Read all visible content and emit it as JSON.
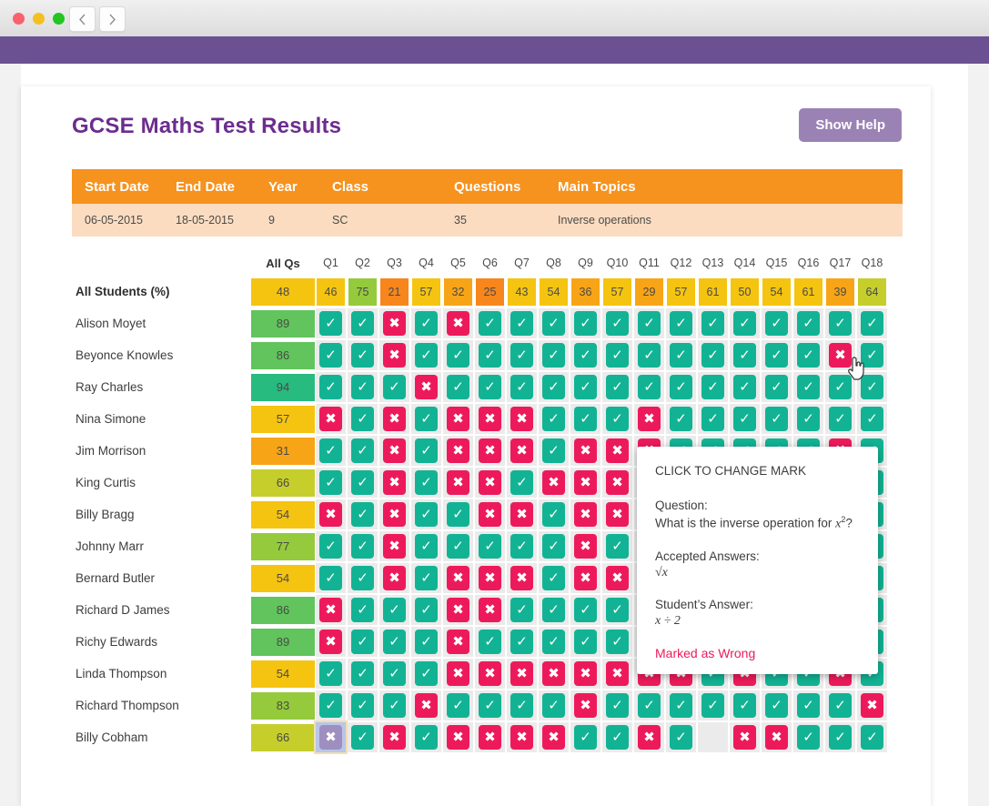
{
  "window": {
    "traffic_lights": [
      "close",
      "minimize",
      "maximize"
    ],
    "back_label": "‹",
    "forward_label": "›",
    "appbar_color": "#6b5191"
  },
  "header": {
    "title": "GCSE Maths Test Results",
    "help_button": "Show Help",
    "title_color": "#6c2d8e",
    "help_color": "#9b82b5"
  },
  "meta_table": {
    "columns": [
      "Start Date",
      "End Date",
      "Year",
      "Class",
      "Questions",
      "Main Topics"
    ],
    "row": [
      "06-05-2015",
      "18-05-2015",
      "9",
      "SC",
      "35",
      "Inverse operations"
    ],
    "header_color": "#f6921e",
    "row_color": "#fbdcc0"
  },
  "grid": {
    "all_qs_label": "All Qs",
    "question_headers": [
      "Q1",
      "Q2",
      "Q3",
      "Q4",
      "Q5",
      "Q6",
      "Q7",
      "Q8",
      "Q9",
      "Q10",
      "Q11",
      "Q12",
      "Q13",
      "Q14",
      "Q15",
      "Q16",
      "Q17",
      "Q18"
    ],
    "summary_row": {
      "label": "All Students (%)",
      "all": 48,
      "values": [
        46,
        75,
        21,
        57,
        32,
        25,
        43,
        54,
        36,
        57,
        29,
        57,
        61,
        50,
        54,
        61,
        39,
        64
      ]
    },
    "students": [
      {
        "name": "Alison Moyet",
        "score": 89,
        "marks": [
          "right",
          "right",
          "wrong",
          "right",
          "wrong",
          "right",
          "right",
          "right",
          "right",
          "right",
          "right",
          "right",
          "right",
          "right",
          "right",
          "right",
          "right",
          "right"
        ]
      },
      {
        "name": "Beyonce Knowles",
        "score": 86,
        "marks": [
          "right",
          "right",
          "wrong",
          "right",
          "right",
          "right",
          "right",
          "right",
          "right",
          "right",
          "right",
          "right",
          "right",
          "right",
          "right",
          "right",
          "wrong",
          "right"
        ]
      },
      {
        "name": "Ray Charles",
        "score": 94,
        "marks": [
          "right",
          "right",
          "right",
          "wrong",
          "right",
          "right",
          "right",
          "right",
          "right",
          "right",
          "right",
          "right",
          "right",
          "right",
          "right",
          "right",
          "right",
          "right"
        ]
      },
      {
        "name": "Nina Simone",
        "score": 57,
        "marks": [
          "wrong",
          "right",
          "wrong",
          "right",
          "wrong",
          "wrong",
          "wrong",
          "right",
          "right",
          "right",
          "wrong",
          "right",
          "right",
          "right",
          "right",
          "right",
          "right",
          "right"
        ]
      },
      {
        "name": "Jim Morrison",
        "score": 31,
        "marks": [
          "right",
          "right",
          "wrong",
          "right",
          "wrong",
          "wrong",
          "wrong",
          "right",
          "wrong",
          "wrong",
          "wrong",
          "right",
          "right",
          "right",
          "right",
          "right",
          "wrong",
          "right"
        ]
      },
      {
        "name": "King Curtis",
        "score": 66,
        "marks": [
          "right",
          "right",
          "wrong",
          "right",
          "wrong",
          "wrong",
          "right",
          "wrong",
          "wrong",
          "wrong",
          "right",
          "right",
          "right",
          "right",
          "right",
          "right",
          "purple",
          "right"
        ]
      },
      {
        "name": "Billy Bragg",
        "score": 54,
        "marks": [
          "wrong",
          "right",
          "wrong",
          "right",
          "right",
          "wrong",
          "wrong",
          "right",
          "wrong",
          "wrong",
          "right",
          "right",
          "right",
          "right",
          "right",
          "right",
          "wrong",
          "right"
        ]
      },
      {
        "name": "Johnny Marr",
        "score": 77,
        "marks": [
          "right",
          "right",
          "wrong",
          "right",
          "right",
          "right",
          "right",
          "right",
          "wrong",
          "right",
          "right",
          "right",
          "right",
          "right",
          "right",
          "right",
          "right",
          "right"
        ]
      },
      {
        "name": "Bernard Butler",
        "score": 54,
        "marks": [
          "right",
          "right",
          "wrong",
          "right",
          "wrong",
          "wrong",
          "wrong",
          "right",
          "wrong",
          "wrong",
          "right",
          "right",
          "wrong",
          "wrong",
          "right",
          "right",
          "wrong",
          "right"
        ]
      },
      {
        "name": "Richard D James",
        "score": 86,
        "marks": [
          "wrong",
          "right",
          "right",
          "right",
          "wrong",
          "wrong",
          "right",
          "right",
          "right",
          "right",
          "right",
          "right",
          "right",
          "right",
          "right",
          "right",
          "right",
          "right"
        ]
      },
      {
        "name": "Richy Edwards",
        "score": 89,
        "marks": [
          "wrong",
          "right",
          "right",
          "right",
          "wrong",
          "right",
          "right",
          "right",
          "right",
          "right",
          "right",
          "right",
          "right",
          "right",
          "wrong",
          "right",
          "right",
          "right"
        ]
      },
      {
        "name": "Linda Thompson",
        "score": 54,
        "marks": [
          "right",
          "right",
          "right",
          "right",
          "wrong",
          "wrong",
          "wrong",
          "wrong",
          "wrong",
          "wrong",
          "wrong",
          "wrong",
          "right",
          "wrong",
          "right",
          "right",
          "wrong",
          "right"
        ]
      },
      {
        "name": "Richard Thompson",
        "score": 83,
        "marks": [
          "right",
          "right",
          "right",
          "wrong",
          "right",
          "right",
          "right",
          "right",
          "wrong",
          "right",
          "right",
          "right",
          "right",
          "right",
          "right",
          "right",
          "right",
          "wrong"
        ]
      },
      {
        "name": "Billy Cobham",
        "score": 66,
        "marks": [
          "selected-wrong",
          "right",
          "wrong",
          "right",
          "wrong",
          "wrong",
          "wrong",
          "wrong",
          "right",
          "right",
          "wrong",
          "right",
          "none",
          "wrong",
          "wrong",
          "right",
          "right",
          "right"
        ]
      }
    ]
  },
  "tooltip": {
    "heading": "CLICK TO CHANGE MARK",
    "question_label": "Question:",
    "question_text_pre": "What is the inverse operation for ",
    "question_var": "x",
    "question_sup": "2",
    "question_text_post": "?",
    "accepted_label": "Accepted Answers:",
    "accepted_value": "√x",
    "student_label": "Student’s Answer:",
    "student_value": "x ÷ 2",
    "status": "Marked as Wrong",
    "status_color": "#ed1a5b"
  }
}
